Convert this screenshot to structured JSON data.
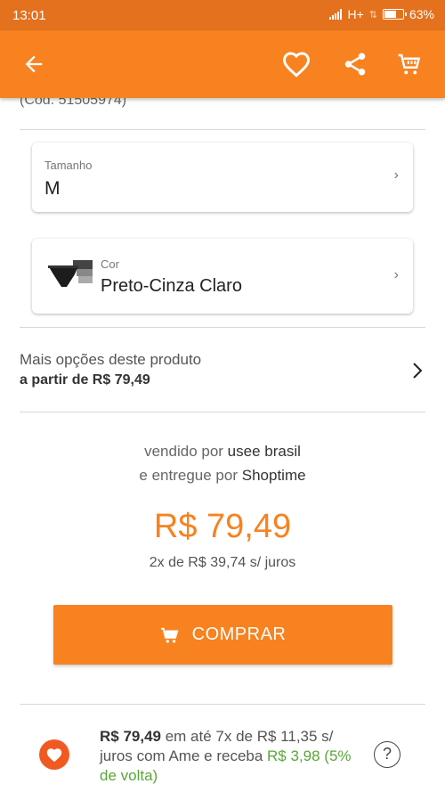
{
  "status_bar": {
    "time": "13:01",
    "network": "H+",
    "battery": "63%",
    "battery_level": 0.63
  },
  "toolbar": {
    "back_icon": "arrow-left-icon",
    "favorite_icon": "heart-outline-icon",
    "share_icon": "share-icon",
    "cart_icon": "cart-icon"
  },
  "product": {
    "code": "(Cód. 51505974)"
  },
  "size_selector": {
    "label": "Tamanho",
    "value": "M"
  },
  "color_selector": {
    "label": "Cor",
    "value": "Preto-Cinza Claro"
  },
  "more_options": {
    "title": "Mais opções deste produto",
    "price_text": "a partir de R$ 79,49"
  },
  "seller": {
    "sold_by_prefix": "vendido por",
    "sold_by": "usee brasil",
    "delivered_by_prefix": "e entregue por",
    "delivered_by": "Shoptime"
  },
  "pricing": {
    "price": "R$ 79,49",
    "installments": "2x de R$ 39,74 s/ juros"
  },
  "buy_button": {
    "label": "COMPRAR"
  },
  "ame_offer": {
    "amount": "R$ 79,49",
    "text1": " em até 7x de R$ 11,35 s/ juros com Ame e receba ",
    "cashback": "R$ 3,98 (5% de volta)",
    "help_icon": "?"
  },
  "colors": {
    "status_bar": "#e4711d",
    "toolbar": "#f7821f",
    "accent": "#f7821f",
    "cashback_green": "#5aa63a"
  }
}
